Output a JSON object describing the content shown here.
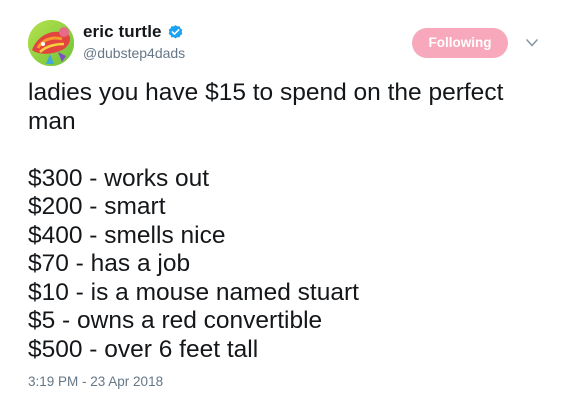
{
  "user": {
    "display_name": "eric turtle",
    "handle": "@dubstep4dads",
    "verified": true,
    "avatar_icon": "sea-turtle-avatar"
  },
  "follow_button": {
    "label": "Following",
    "color": "#f7a8ba"
  },
  "menu_icon": "chevron-down-icon",
  "tweet": {
    "intro_lines": [
      "ladies you have $15 to spend on the perfect",
      "man"
    ],
    "list_items": [
      "$300 - works out",
      "$200 - smart",
      "$400 - smells nice",
      "$70 - has a job",
      "$10 - is a mouse named stuart",
      "$5 - owns a red convertible",
      "$500 - over 6 feet tall"
    ]
  },
  "timestamp": "3:19 PM - 23 Apr 2018",
  "colors": {
    "text": "#14171a",
    "secondary": "#657786",
    "verified": "#1da1f2"
  }
}
